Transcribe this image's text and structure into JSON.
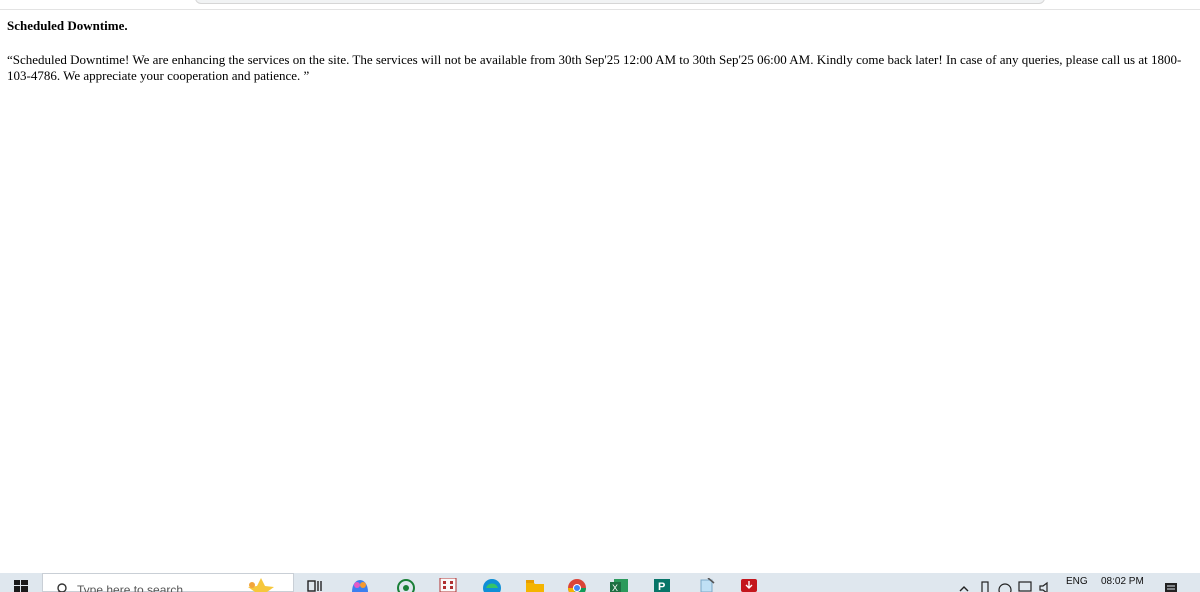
{
  "page": {
    "title": "Scheduled Downtime.",
    "message": "“Scheduled Downtime! We are enhancing the services on the site. The services will not be available from 30th Sep'25 12:00 AM to 30th Sep'25 06:00 AM. Kindly come back later! In case of any queries, please call us at 1800-103-4786. We appreciate your cooperation and patience. ”"
  },
  "taskbar": {
    "search_placeholder": "Type here to search",
    "language": "ENG",
    "time": "08:02 PM",
    "icons": [
      "windows-start-icon",
      "search-icon",
      "widgets-icon",
      "task-view-icon",
      "copilot-icon",
      "whatsapp-icon",
      "calculator-icon",
      "edge-icon",
      "file-explorer-icon",
      "chrome-icon",
      "excel-icon",
      "publisher-icon",
      "notepad-icon",
      "acrobat-icon"
    ],
    "tray_icons": [
      "chevron-up-icon",
      "battery-icon",
      "network-icon",
      "monitor-icon",
      "volume-icon"
    ],
    "colors": {
      "taskbar_bg": "#dfe7ee",
      "excel": "#1d6f42",
      "publisher": "#077568",
      "acrobat": "#c4161c",
      "edge": "#0f8fd6",
      "chrome_red": "#db4437",
      "explorer": "#f4b400"
    }
  }
}
